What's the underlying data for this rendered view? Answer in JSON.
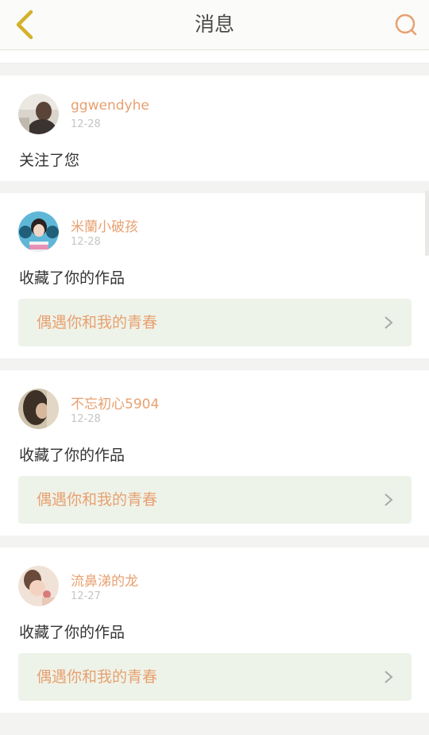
{
  "header": {
    "title": "消息",
    "back_icon": "chevron-left-icon",
    "search_icon": "search-icon",
    "accent_color": "#e8a070",
    "back_color": "#d4b12a"
  },
  "messages": [
    {
      "username": "ggwendyhe",
      "date": "12-28",
      "action": "关注了您",
      "type": "follow"
    },
    {
      "username": "米蘭小破孩",
      "date": "12-28",
      "action": "收藏了你的作品",
      "type": "favorite",
      "work_title": "偶遇你和我的青春"
    },
    {
      "username": "不忘初心5904",
      "date": "12-28",
      "action": "收藏了你的作品",
      "type": "favorite",
      "work_title": "偶遇你和我的青春"
    },
    {
      "username": "流鼻涕的龙",
      "date": "12-27",
      "action": "收藏了你的作品",
      "type": "favorite",
      "work_title": "偶遇你和我的青春"
    }
  ]
}
